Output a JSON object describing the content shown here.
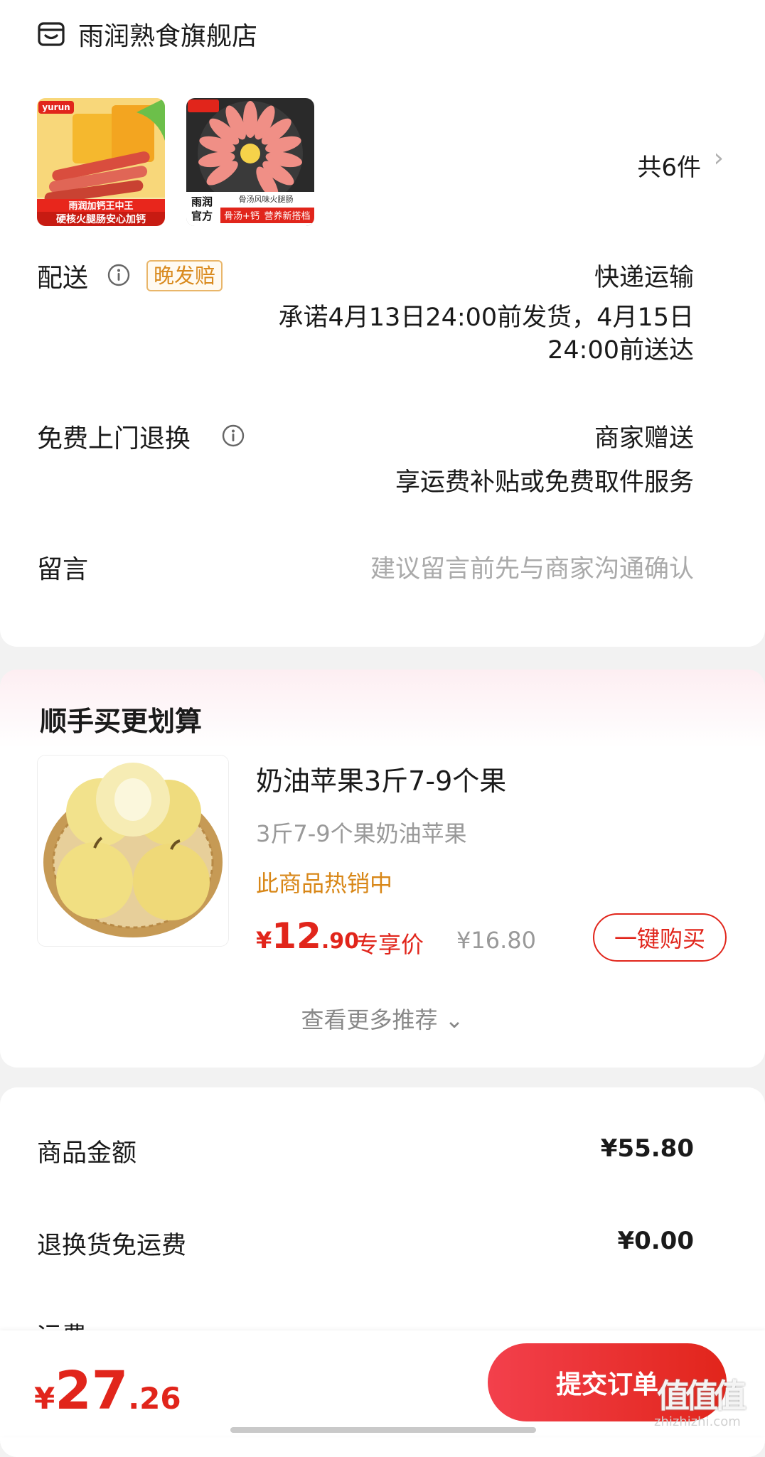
{
  "store": {
    "name": "雨润熟食旗舰店",
    "icon": "store-icon"
  },
  "items": {
    "count_label": "共6件",
    "thumb1": {
      "brand": "yurun",
      "line1": "雨润加钙王中王",
      "line2": "硬核火腿肠安心加钙"
    },
    "thumb2": {
      "brand": "雨润官方",
      "caption": "骨汤风味火腿肠",
      "badge": "骨汤+钙",
      "line": "营养新搭档"
    }
  },
  "delivery": {
    "label": "配送",
    "tag": "晚发赔",
    "method": "快递运输",
    "promise_line1": "承诺4月13日24:00前发货，4月15日",
    "promise_line2": "24:00前送达"
  },
  "returns": {
    "label": "免费上门退换",
    "value": "商家赠送",
    "desc": "享运费补贴或免费取件服务"
  },
  "message": {
    "label": "留言",
    "placeholder": "建议留言前先与商家沟通确认"
  },
  "recommend": {
    "title": "顺手买更划算",
    "product": {
      "name": "奶油苹果3斤7-9个果",
      "subtitle": "3斤7-9个果奶油苹果",
      "hot": "此商品热销中",
      "price_symbol": "¥",
      "price_int": "12",
      "price_dec": ".90",
      "exclusive": "专享价",
      "original": "¥16.80",
      "buy_label": "一键购买"
    },
    "more_label": "查看更多推荐 ⌄"
  },
  "summary": {
    "goods_label": "商品金额",
    "goods_value": "¥55.80",
    "return_free_label": "退换货免运费",
    "return_free_value": "¥0.00",
    "shipping_label": "运费"
  },
  "bottom": {
    "total_symbol": "¥",
    "total_int": "27",
    "total_dec": ".26",
    "submit_label": "提交订单",
    "watermark": "值值值",
    "watermark_site": "zhizhizhi.com"
  },
  "colors": {
    "accent": "#e1251b",
    "warning": "#d98a1e"
  }
}
